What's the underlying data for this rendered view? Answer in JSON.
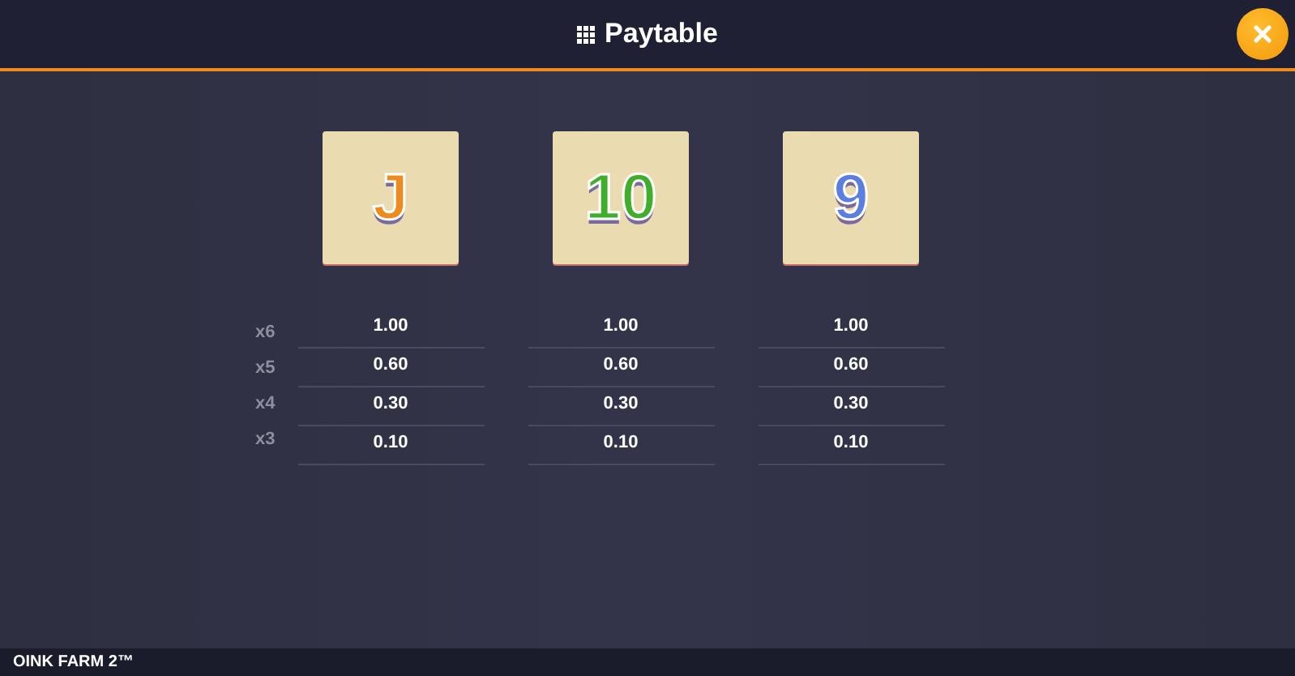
{
  "header": {
    "title": "Paytable"
  },
  "paytable": {
    "multipliers": [
      "x6",
      "x5",
      "x4",
      "x3"
    ],
    "symbols": [
      {
        "label": "J",
        "color": "#f08a1c",
        "pays": [
          "1.00",
          "0.60",
          "0.30",
          "0.10"
        ]
      },
      {
        "label": "10",
        "color": "#3fae2a",
        "pays": [
          "1.00",
          "0.60",
          "0.30",
          "0.10"
        ]
      },
      {
        "label": "9",
        "color": "#5b7fe0",
        "pays": [
          "1.00",
          "0.60",
          "0.30",
          "0.10"
        ]
      }
    ]
  },
  "footer": {
    "game_name": "OINK FARM 2™"
  }
}
